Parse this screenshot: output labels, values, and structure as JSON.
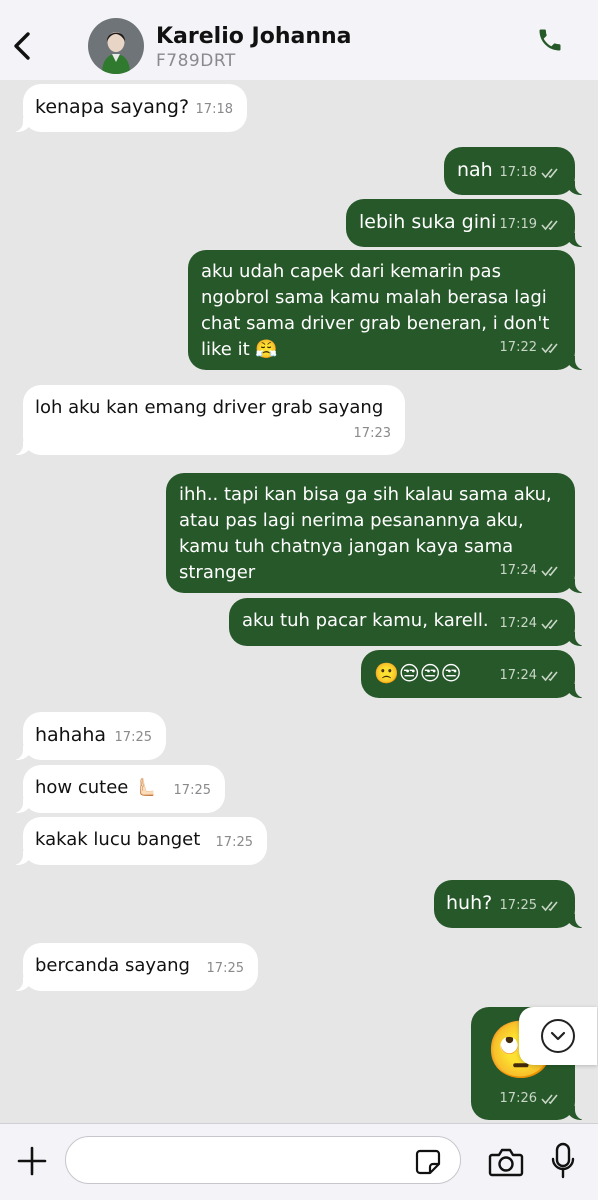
{
  "header": {
    "back_icon": "chevron-left-icon",
    "name": "Karelio Johanna",
    "subtitle": "F789DRT",
    "call_icon": "phone-icon",
    "accent_color": "#27582a"
  },
  "messages": [
    {
      "dir": "in",
      "text": "kenapa sayang?",
      "time": "17:18"
    },
    {
      "dir": "out",
      "text": "nah",
      "time": "17:18",
      "status": "read"
    },
    {
      "dir": "out",
      "text": "lebih suka gini",
      "time": "17:19",
      "status": "read"
    },
    {
      "dir": "out",
      "text": "aku udah capek dari kemarin pas ngobrol sama kamu malah berasa lagi chat sama driver grab beneran, i don't like it 😤",
      "time": "17:22",
      "status": "read"
    },
    {
      "dir": "in",
      "text": "loh aku kan emang driver grab sayang",
      "time": "17:23"
    },
    {
      "dir": "out",
      "text": "ihh.. tapi kan bisa ga sih kalau sama aku, atau pas lagi nerima pesanannya aku, kamu tuh chatnya jangan kaya sama stranger",
      "time": "17:24",
      "status": "read"
    },
    {
      "dir": "out",
      "text": "aku tuh pacar kamu, karell.",
      "time": "17:24",
      "status": "read"
    },
    {
      "dir": "out",
      "text": "🙁😒😒😒",
      "time": "17:24",
      "status": "read"
    },
    {
      "dir": "in",
      "text": "hahaha",
      "time": "17:25"
    },
    {
      "dir": "in",
      "text": "how cutee 🫷🏻",
      "time": "17:25"
    },
    {
      "dir": "in",
      "text": "kakak lucu banget",
      "time": "17:25"
    },
    {
      "dir": "out",
      "text": "huh?",
      "time": "17:25",
      "status": "read"
    },
    {
      "dir": "in",
      "text": "bercanda sayang",
      "time": "17:25"
    },
    {
      "dir": "out",
      "text": "🙄",
      "time": "17:26",
      "status": "read"
    }
  ],
  "scroll_down_icon": "chevron-down-circle-icon",
  "input": {
    "placeholder": "",
    "value": "",
    "add_icon": "plus-icon",
    "sticker_icon": "sticker-icon",
    "camera_icon": "camera-icon",
    "mic_icon": "microphone-icon"
  }
}
